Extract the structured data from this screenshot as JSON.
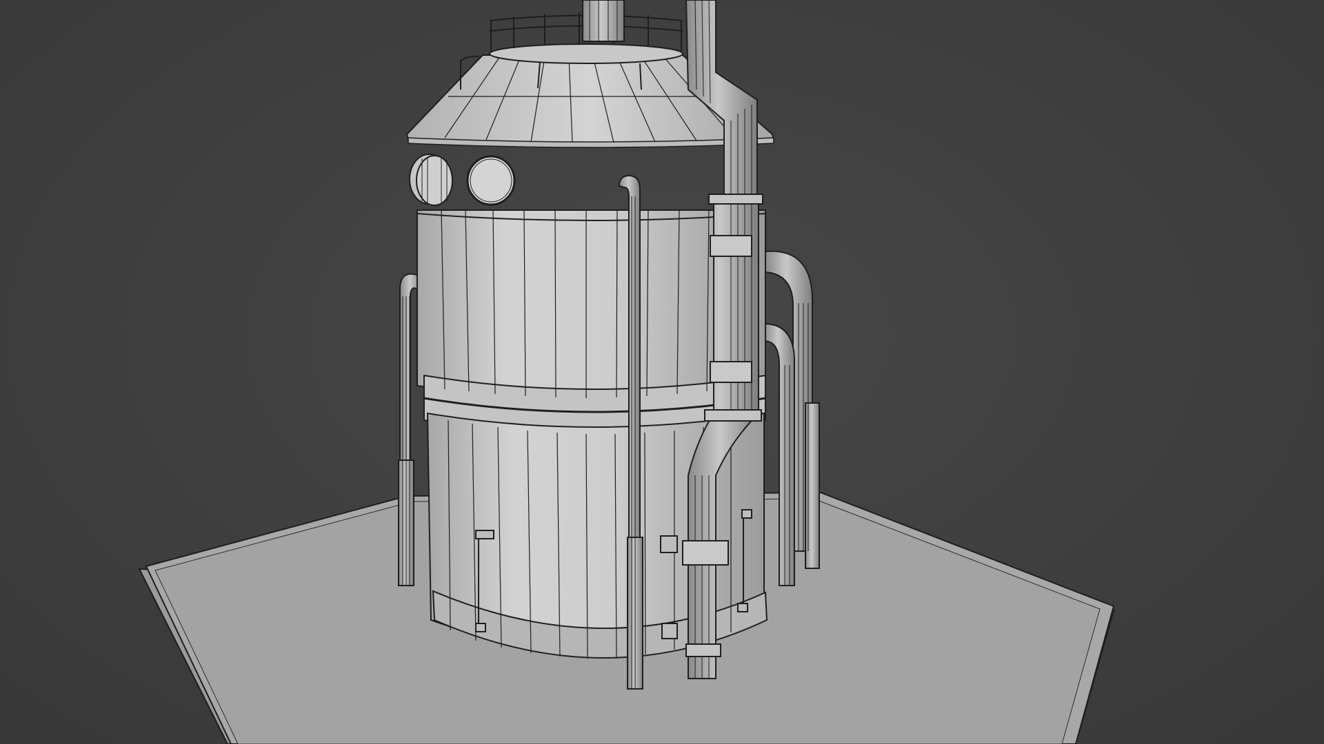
{
  "viewport": {
    "mode": "Solid",
    "overlay": "Wireframe",
    "background_color": "#3d3d3d"
  },
  "scene": {
    "object": "industrial-storage-tank",
    "colors": {
      "surface": "#c9c9c9",
      "surface_light": "#d8d8d8",
      "surface_shadow": "#9a9a9a",
      "wire": "#1e1e1e",
      "ground": "#a5a5a5",
      "ground_edge": "#8c8c8c"
    }
  }
}
